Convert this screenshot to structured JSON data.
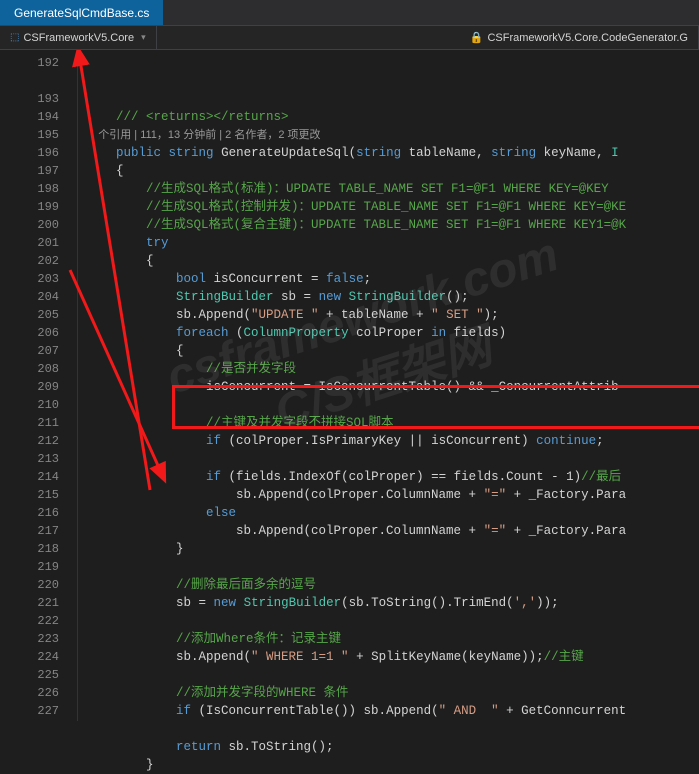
{
  "tab": {
    "title": "GenerateSqlCmdBase.cs"
  },
  "nav": {
    "left_label": "CSFrameworkV5.Core",
    "right_label": "CSFrameworkV5.Core.CodeGenerator.G"
  },
  "watermark": {
    "line1": "csframework.com",
    "line2": "C/S框架网"
  },
  "codelens": "个引用 | 111，13 分钟前 | 2 名作者，2 项更改",
  "lines": {
    "192": {
      "indent": "    ",
      "parts": [
        {
          "t": "/// ",
          "c": "comment"
        },
        {
          "t": "<returns></returns>",
          "c": "comment"
        }
      ]
    },
    "193": {
      "indent": "    ",
      "parts": [
        {
          "t": "public",
          "c": "keyword"
        },
        {
          "t": " "
        },
        {
          "t": "string",
          "c": "keyword"
        },
        {
          "t": " GenerateUpdateSql("
        },
        {
          "t": "string",
          "c": "keyword"
        },
        {
          "t": " tableName, "
        },
        {
          "t": "string",
          "c": "keyword"
        },
        {
          "t": " keyName, "
        },
        {
          "t": "I",
          "c": "type"
        }
      ]
    },
    "194": {
      "indent": "    ",
      "parts": [
        {
          "t": "{"
        }
      ]
    },
    "195": {
      "indent": "        ",
      "parts": [
        {
          "t": "//生成SQL格式(标准)：UPDATE TABLE_NAME SET F1=@F1 WHERE KEY=@KEY",
          "c": "comment"
        }
      ]
    },
    "196": {
      "indent": "        ",
      "parts": [
        {
          "t": "//生成SQL格式(控制并发)：UPDATE TABLE_NAME SET F1=@F1 WHERE KEY=@KE",
          "c": "comment"
        }
      ]
    },
    "197": {
      "indent": "        ",
      "parts": [
        {
          "t": "//生成SQL格式(复合主键)：UPDATE TABLE_NAME SET F1=@F1 WHERE KEY1=@K",
          "c": "comment"
        }
      ]
    },
    "198": {
      "indent": "        ",
      "parts": [
        {
          "t": "try",
          "c": "keyword"
        }
      ]
    },
    "199": {
      "indent": "        ",
      "parts": [
        {
          "t": "{"
        }
      ]
    },
    "200": {
      "indent": "            ",
      "parts": [
        {
          "t": "bool",
          "c": "keyword"
        },
        {
          "t": " isConcurrent = "
        },
        {
          "t": "false",
          "c": "keyword"
        },
        {
          "t": ";"
        }
      ]
    },
    "201": {
      "indent": "            ",
      "parts": [
        {
          "t": "StringBuilder",
          "c": "type"
        },
        {
          "t": " sb = "
        },
        {
          "t": "new",
          "c": "keyword"
        },
        {
          "t": " "
        },
        {
          "t": "StringBuilder",
          "c": "type"
        },
        {
          "t": "();"
        }
      ]
    },
    "202": {
      "indent": "            ",
      "parts": [
        {
          "t": "sb.Append("
        },
        {
          "t": "\"UPDATE \"",
          "c": "string"
        },
        {
          "t": " + tableName + "
        },
        {
          "t": "\" SET \"",
          "c": "string"
        },
        {
          "t": ");"
        }
      ]
    },
    "203": {
      "indent": "            ",
      "parts": [
        {
          "t": "foreach",
          "c": "keyword"
        },
        {
          "t": " ("
        },
        {
          "t": "ColumnProperty",
          "c": "type"
        },
        {
          "t": " colProper "
        },
        {
          "t": "in",
          "c": "keyword"
        },
        {
          "t": " fields)"
        }
      ]
    },
    "204": {
      "indent": "            ",
      "parts": [
        {
          "t": "{"
        }
      ]
    },
    "205": {
      "indent": "                ",
      "parts": [
        {
          "t": "//是否并发字段",
          "c": "comment"
        }
      ]
    },
    "206": {
      "indent": "                ",
      "parts": [
        {
          "t": "isConcurrent = IsConcurrentTable() && _ConcurrentAttrib"
        }
      ]
    },
    "207": {
      "indent": "",
      "parts": []
    },
    "208": {
      "indent": "                ",
      "parts": [
        {
          "t": "//主键及并发字段不拼接SQL脚本",
          "c": "comment"
        }
      ]
    },
    "209": {
      "indent": "                ",
      "parts": [
        {
          "t": "if",
          "c": "keyword"
        },
        {
          "t": " (colProper.IsPrimaryKey || isConcurrent) "
        },
        {
          "t": "continue",
          "c": "keyword"
        },
        {
          "t": ";"
        }
      ]
    },
    "210": {
      "indent": "",
      "parts": []
    },
    "211": {
      "indent": "                ",
      "parts": [
        {
          "t": "if",
          "c": "keyword"
        },
        {
          "t": " (fields.IndexOf(colProper) == fields.Count - 1)"
        },
        {
          "t": "//最后",
          "c": "comment"
        }
      ]
    },
    "212": {
      "indent": "                    ",
      "parts": [
        {
          "t": "sb.Append(colProper.ColumnName + "
        },
        {
          "t": "\"=\"",
          "c": "string"
        },
        {
          "t": " + _Factory.Para"
        }
      ]
    },
    "213": {
      "indent": "                ",
      "parts": [
        {
          "t": "else",
          "c": "keyword"
        }
      ]
    },
    "214": {
      "indent": "                    ",
      "parts": [
        {
          "t": "sb.Append(colProper.ColumnName + "
        },
        {
          "t": "\"=\"",
          "c": "string"
        },
        {
          "t": " + _Factory.Para"
        }
      ]
    },
    "215": {
      "indent": "            ",
      "parts": [
        {
          "t": "}"
        }
      ]
    },
    "216": {
      "indent": "",
      "parts": []
    },
    "217": {
      "indent": "            ",
      "parts": [
        {
          "t": "//删除最后面多余的逗号",
          "c": "comment"
        }
      ]
    },
    "218": {
      "indent": "            ",
      "parts": [
        {
          "t": "sb = "
        },
        {
          "t": "new",
          "c": "keyword"
        },
        {
          "t": " "
        },
        {
          "t": "StringBuilder",
          "c": "type"
        },
        {
          "t": "(sb.ToString().TrimEnd("
        },
        {
          "t": "','",
          "c": "string"
        },
        {
          "t": "));"
        }
      ]
    },
    "219": {
      "indent": "",
      "parts": []
    },
    "220": {
      "indent": "            ",
      "parts": [
        {
          "t": "//添加Where条件：记录主键",
          "c": "comment"
        }
      ]
    },
    "221": {
      "indent": "            ",
      "parts": [
        {
          "t": "sb.Append("
        },
        {
          "t": "\" WHERE 1=1 \"",
          "c": "string"
        },
        {
          "t": " + SplitKeyName(keyName));"
        },
        {
          "t": "//主键",
          "c": "comment"
        }
      ]
    },
    "222": {
      "indent": "",
      "parts": []
    },
    "223": {
      "indent": "            ",
      "parts": [
        {
          "t": "//添加并发字段的WHERE 条件",
          "c": "comment"
        }
      ]
    },
    "224": {
      "indent": "            ",
      "parts": [
        {
          "t": "if",
          "c": "keyword"
        },
        {
          "t": " (IsConcurrentTable()) sb.Append("
        },
        {
          "t": "\" AND  \"",
          "c": "string"
        },
        {
          "t": " + GetConncurrent"
        }
      ]
    },
    "225": {
      "indent": "",
      "parts": []
    },
    "226": {
      "indent": "            ",
      "parts": [
        {
          "t": "return",
          "c": "keyword"
        },
        {
          "t": " sb.ToString();"
        }
      ]
    },
    "227": {
      "indent": "        ",
      "parts": [
        {
          "t": "}"
        }
      ]
    }
  },
  "first_line": 192,
  "last_line": 227
}
